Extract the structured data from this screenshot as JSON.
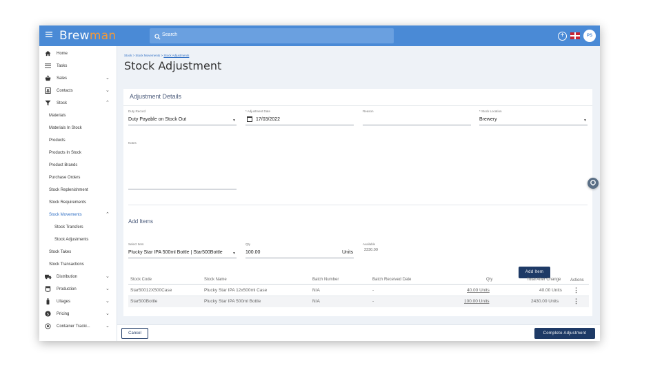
{
  "app": {
    "logo_left": "Brew",
    "logo_right": "man",
    "search_placeholder": "Search",
    "user_initials": "PS",
    "icons": {
      "menu": "hamburger-icon",
      "search": "search-icon",
      "add": "plus-circle-icon",
      "lang": "uk-flag-icon",
      "help": "help-icon"
    }
  },
  "sidebar": {
    "items": [
      {
        "label": "Home",
        "icon": "home-icon"
      },
      {
        "label": "Tasks",
        "icon": "list-icon"
      },
      {
        "label": "Sales",
        "icon": "basket-icon",
        "chevron": "down"
      },
      {
        "label": "Contacts",
        "icon": "contacts-icon",
        "chevron": "down"
      },
      {
        "label": "Stock",
        "icon": "funnel-icon",
        "chevron": "up"
      },
      {
        "label": "Materials"
      },
      {
        "label": "Materials In Stock"
      },
      {
        "label": "Products"
      },
      {
        "label": "Products In Stock"
      },
      {
        "label": "Product Brands"
      },
      {
        "label": "Purchase Orders"
      },
      {
        "label": "Stock Replenishment"
      },
      {
        "label": "Stock Requirements"
      },
      {
        "label": "Stock Movements",
        "chevron": "up",
        "active": true
      },
      {
        "label": "Stock Transfers"
      },
      {
        "label": "Stock Adjustments"
      },
      {
        "label": "Stock Takes"
      },
      {
        "label": "Stock Transactions"
      },
      {
        "label": "Distribution",
        "icon": "truck-icon",
        "chevron": "down"
      },
      {
        "label": "Production",
        "icon": "vat-icon",
        "chevron": "down"
      },
      {
        "label": "Ullages",
        "icon": "bottle-icon",
        "chevron": "down"
      },
      {
        "label": "Pricing",
        "icon": "price-icon",
        "chevron": "down"
      },
      {
        "label": "Container Tracki...",
        "icon": "target-icon",
        "chevron": "down"
      }
    ]
  },
  "breadcrumb": {
    "part1": "Stock",
    "sep": " > ",
    "part2": "Stock Movements",
    "part3": "Stock Adjustments"
  },
  "page_title": "Stock Adjustment",
  "details": {
    "title": "Adjustment Details",
    "duty_record_label": "Duty Record",
    "duty_record_value": "Duty Payable on Stock Out",
    "adjustment_date_label": "* Adjustment Date",
    "adjustment_date_value": "17/03/2022",
    "reason_label": "Reason",
    "reason_value": "",
    "stock_location_label": "* Stock Location",
    "stock_location_value": "Brewery",
    "notes_label": "Notes",
    "notes_value": ""
  },
  "add_items": {
    "title": "Add Items",
    "select_item_label": "Select Item",
    "select_item_value": "Plucky Star IPA 500ml Bottle | Star500Bottle",
    "qty_label": "Qty",
    "qty_value": "100.00",
    "qty_unit": "Units",
    "available_label": "Available",
    "available_value": "2330.00",
    "add_button": "Add Item"
  },
  "table": {
    "headers": [
      "Stock Code",
      "Stock Name",
      "Batch Number",
      "Batch Received Date",
      "Qty",
      "Total After Change",
      "Actions"
    ],
    "rows": [
      [
        "Star50012X500Case",
        "Plucky Star IPA 12x500ml Case",
        "N/A",
        "-",
        "40.00 Units",
        "40.00 Units"
      ],
      [
        "Star500Bottle",
        "Plucky Star IPA 500ml Bottle",
        "N/A",
        "-",
        "100.00 Units",
        "2430.00 Units"
      ]
    ]
  },
  "footer": {
    "cancel": "Cancel",
    "complete": "Complete Adjustment"
  },
  "colors": {
    "topbar": "#4a8ad6",
    "logo_accent": "#f2993a",
    "primary_button": "#1e3a66",
    "link": "#2f6fc4"
  }
}
